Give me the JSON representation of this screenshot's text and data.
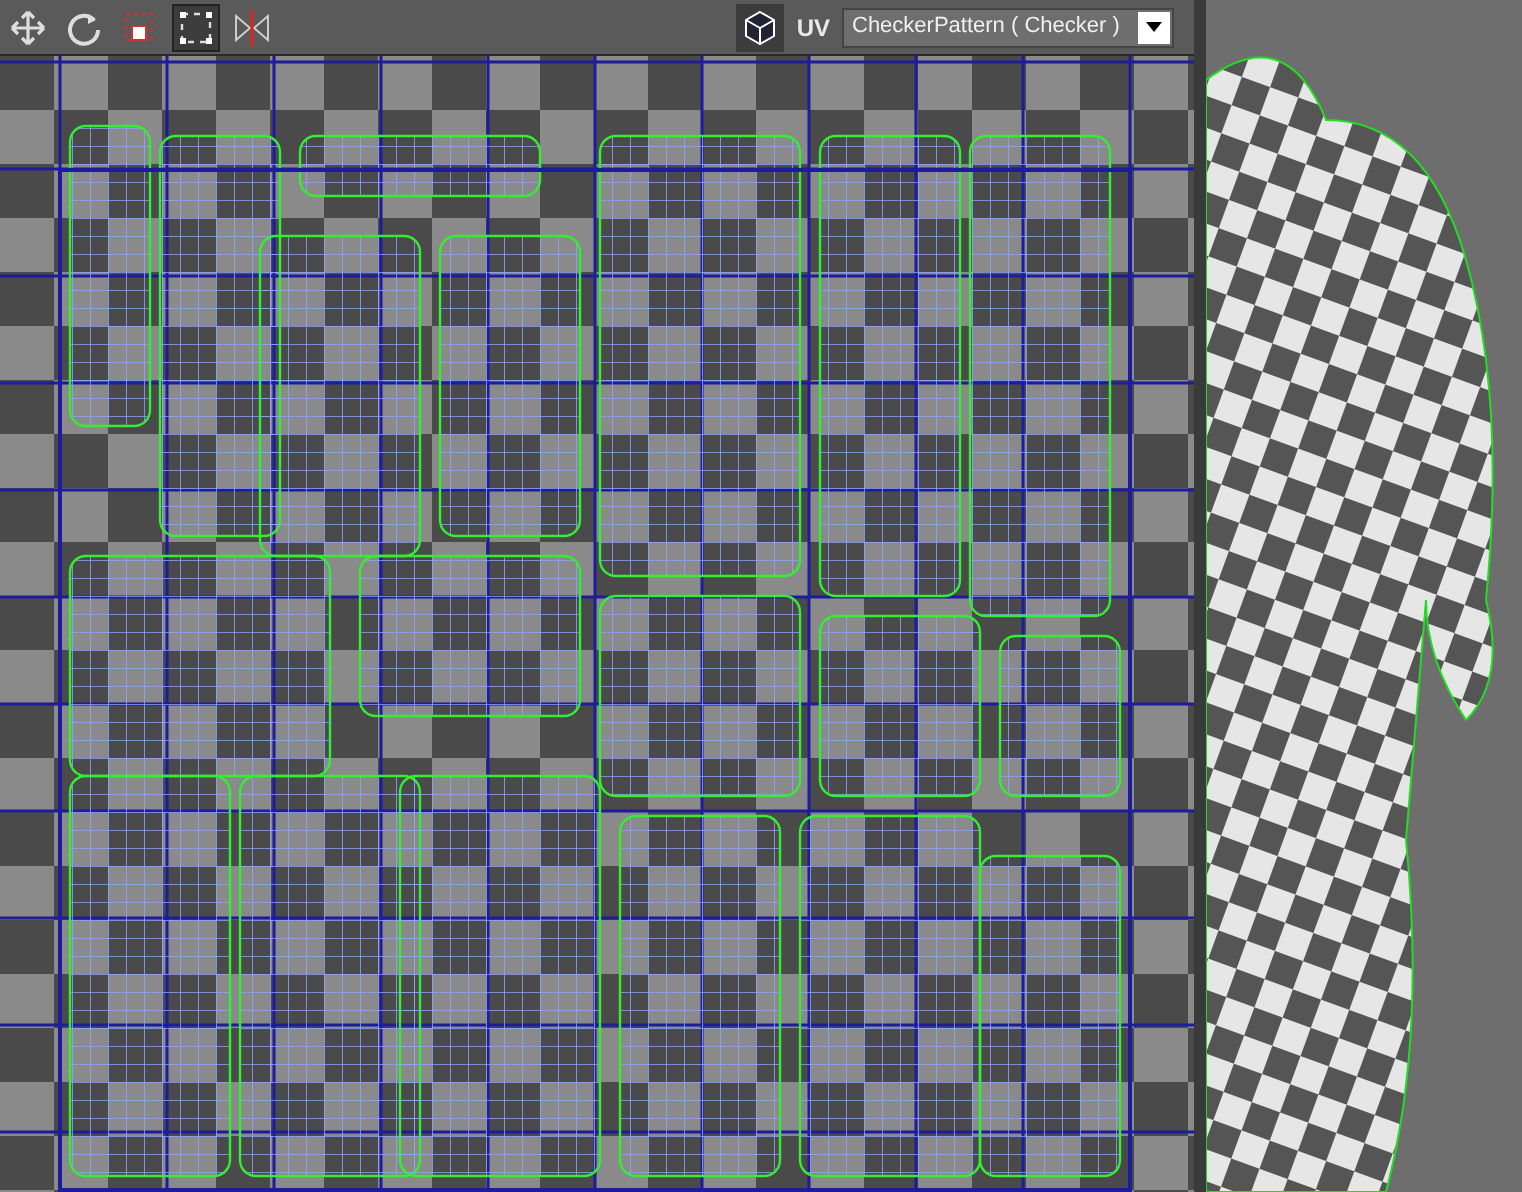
{
  "toolbar": {
    "tools": [
      {
        "kind": "move",
        "selected": false
      },
      {
        "kind": "rotate",
        "selected": false
      },
      {
        "kind": "scale",
        "selected": false
      },
      {
        "kind": "freeform",
        "selected": true
      },
      {
        "kind": "mirror",
        "selected": false
      }
    ],
    "uv_label": "UV",
    "map_dropdown": {
      "value": "CheckerPattern ( Checker )"
    }
  }
}
